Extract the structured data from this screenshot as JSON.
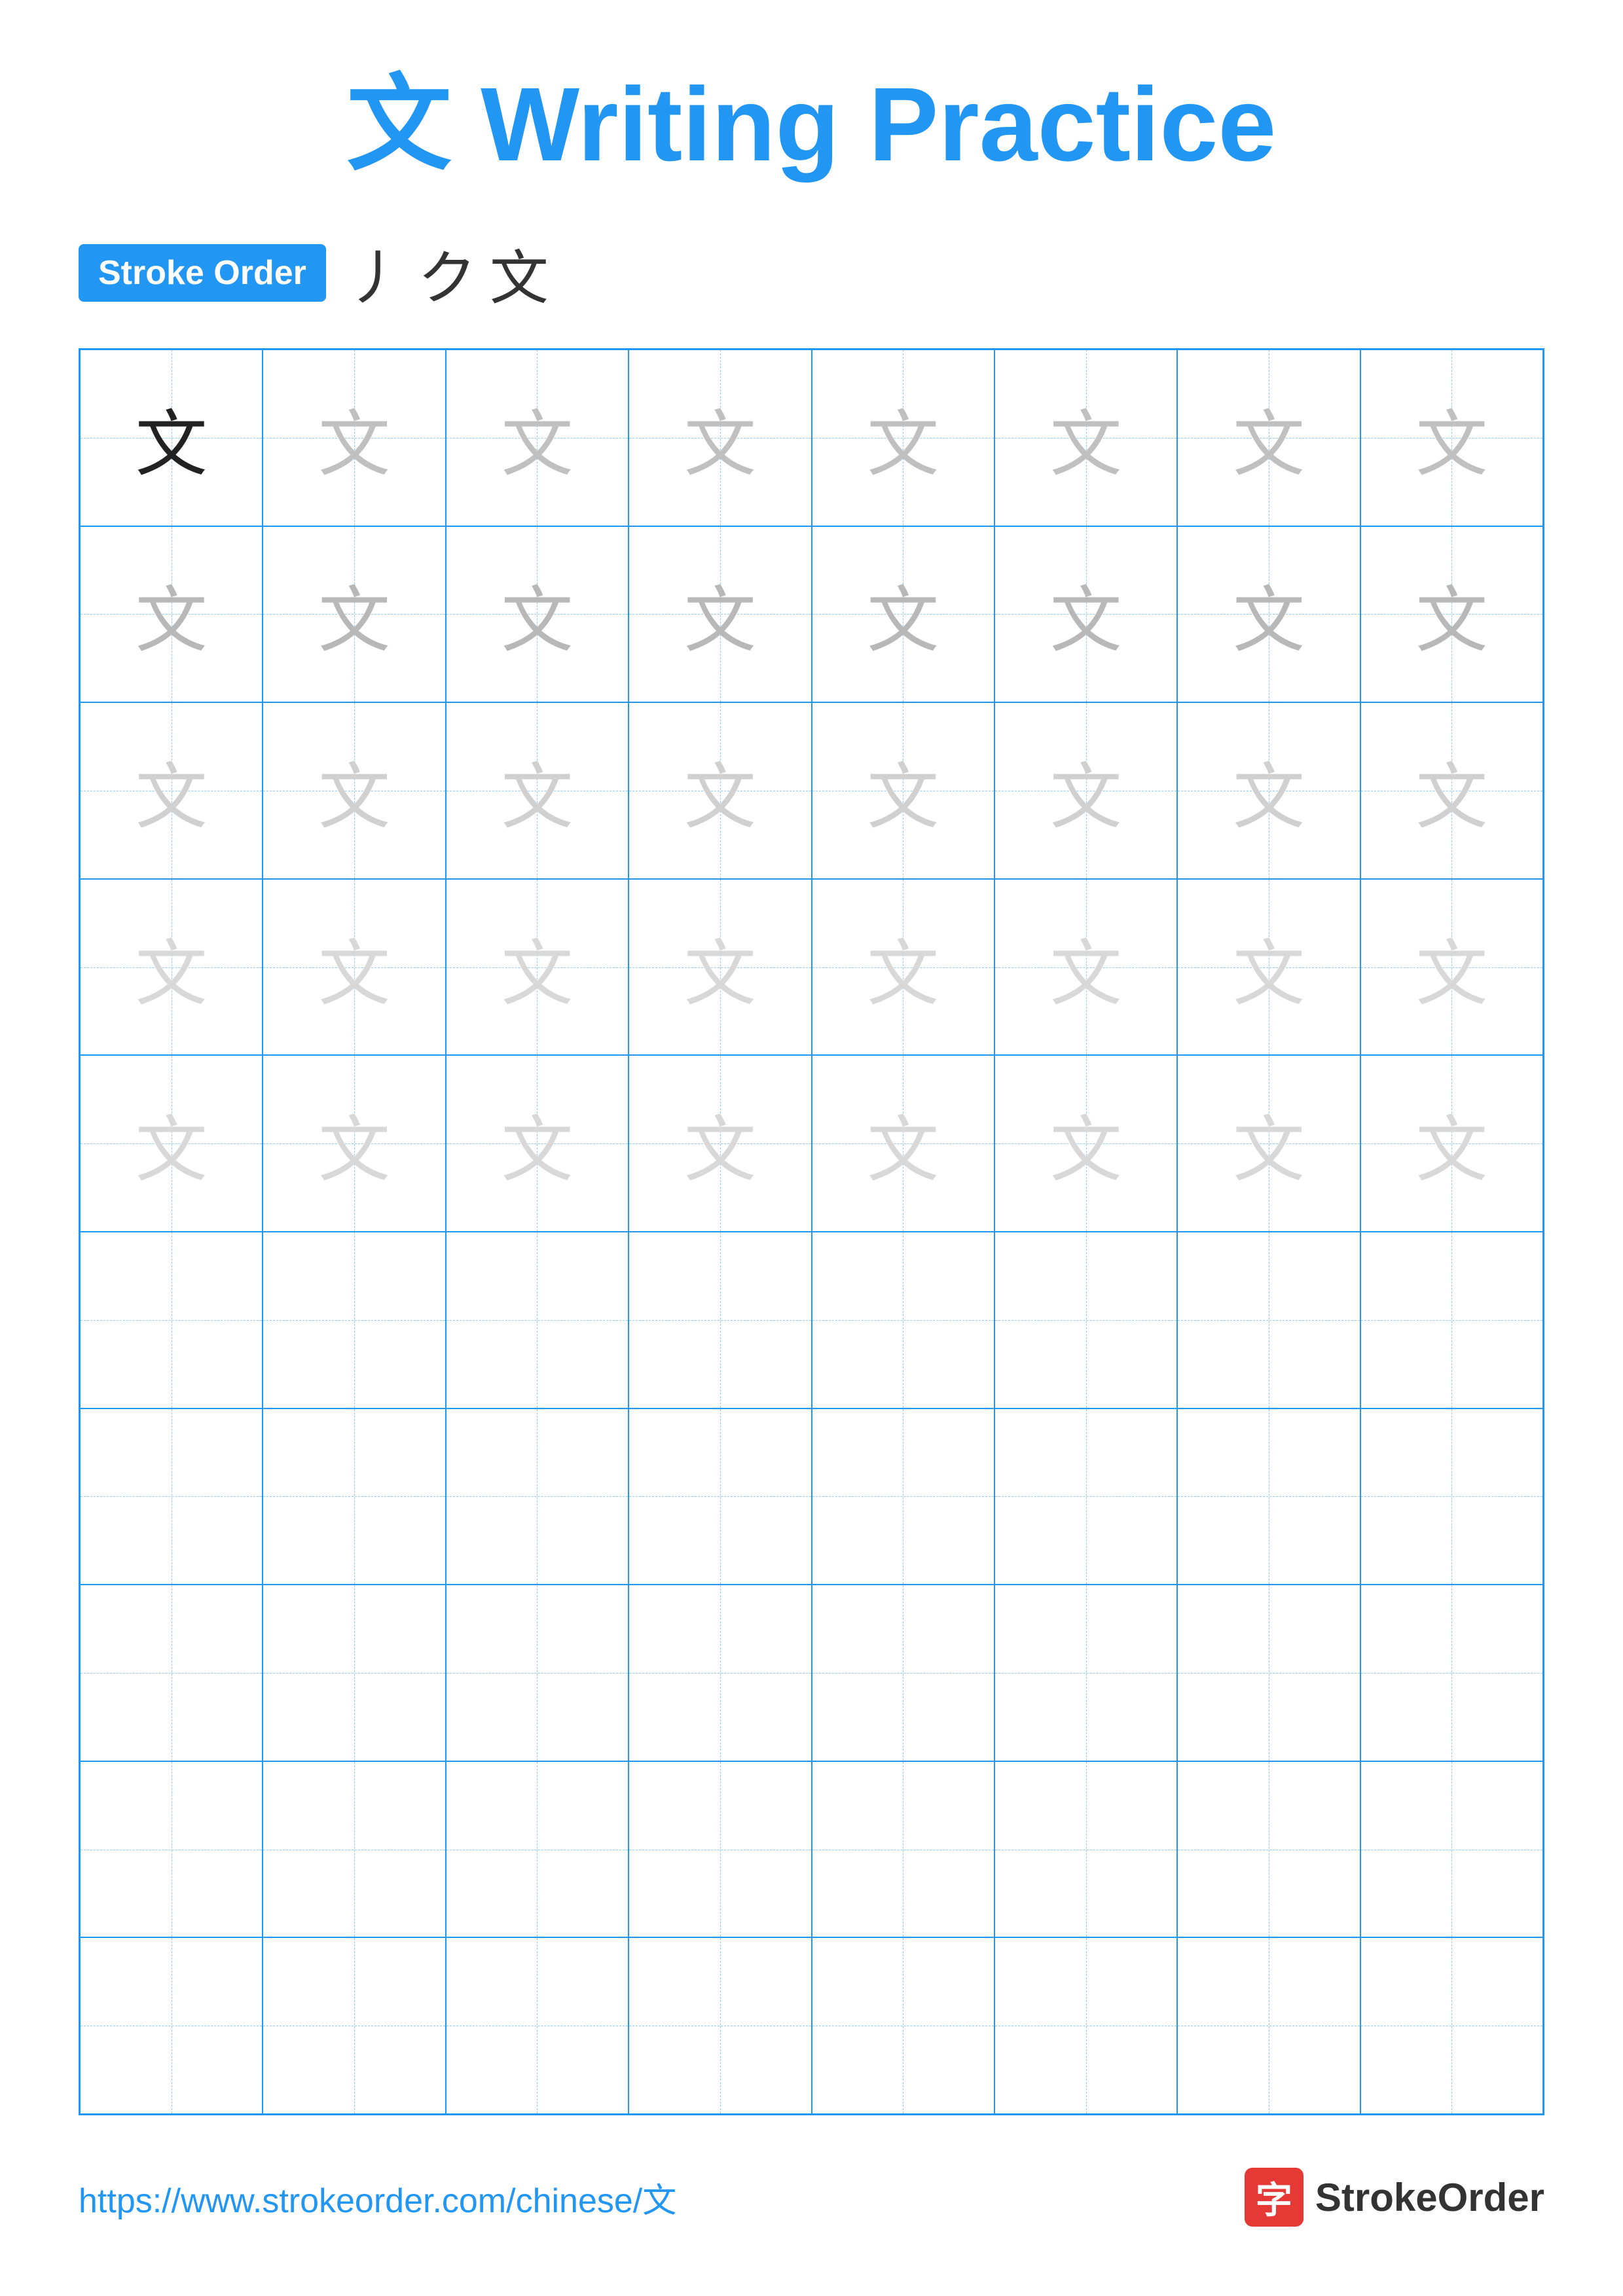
{
  "title": {
    "char": "文",
    "text": "Writing Practice",
    "full": "文 Writing Practice"
  },
  "stroke_order": {
    "badge_label": "Stroke Order",
    "strokes": [
      "丿",
      "ク",
      "文"
    ]
  },
  "grid": {
    "cols": 8,
    "rows": 10,
    "char": "文",
    "guide_char": "文",
    "filled_rows": 5,
    "empty_rows": 5
  },
  "footer": {
    "url": "https://www.strokeorder.com/chinese/文",
    "logo_char": "字",
    "logo_text": "StrokeOrder"
  }
}
